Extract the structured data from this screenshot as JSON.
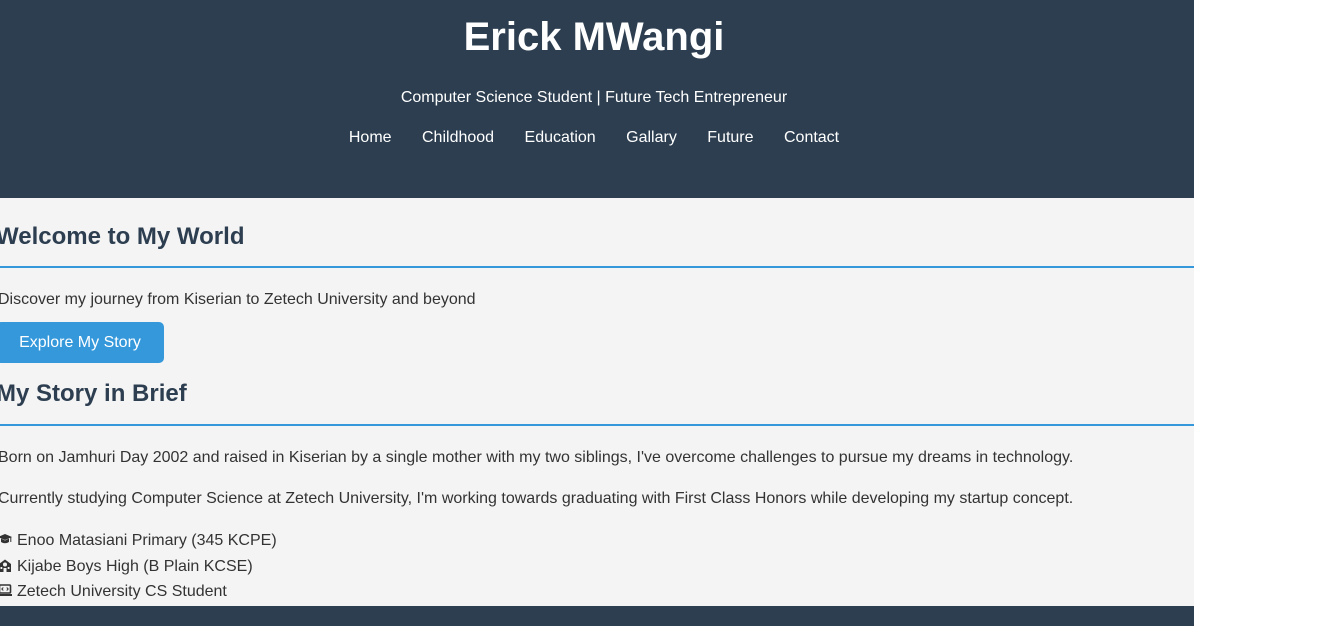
{
  "header": {
    "title": "Erick MWangi",
    "tagline": "Computer Science Student | Future Tech Entrepreneur",
    "nav": [
      {
        "label": "Home"
      },
      {
        "label": "Childhood"
      },
      {
        "label": "Education"
      },
      {
        "label": "Gallary"
      },
      {
        "label": "Future"
      },
      {
        "label": "Contact"
      }
    ]
  },
  "welcome": {
    "heading": "Welcome to My World",
    "text": "Discover my journey from Kiserian to Zetech University and beyond",
    "button_label": "Explore My Story"
  },
  "story": {
    "heading": "My Story in Brief",
    "paragraphs": [
      "Born on Jamhuri Day 2002 and raised in Kiserian by a single mother with my two siblings, I've overcome challenges to pursue my dreams in technology.",
      "Currently studying Computer Science at Zetech University, I'm working towards graduating with First Class Honors while developing my startup concept."
    ],
    "milestones": [
      {
        "icon": "graduation-cap-icon",
        "text": "Enoo Matasiani Primary (345 KCPE)"
      },
      {
        "icon": "school-icon",
        "text": "Kijabe Boys High (B Plain KCSE)"
      },
      {
        "icon": "laptop-code-icon",
        "text": "Zetech University CS Student"
      }
    ]
  },
  "colors": {
    "header_bg": "#2c3e50",
    "accent": "#3498db",
    "page_bg": "#f4f4f4",
    "text": "#333333"
  }
}
